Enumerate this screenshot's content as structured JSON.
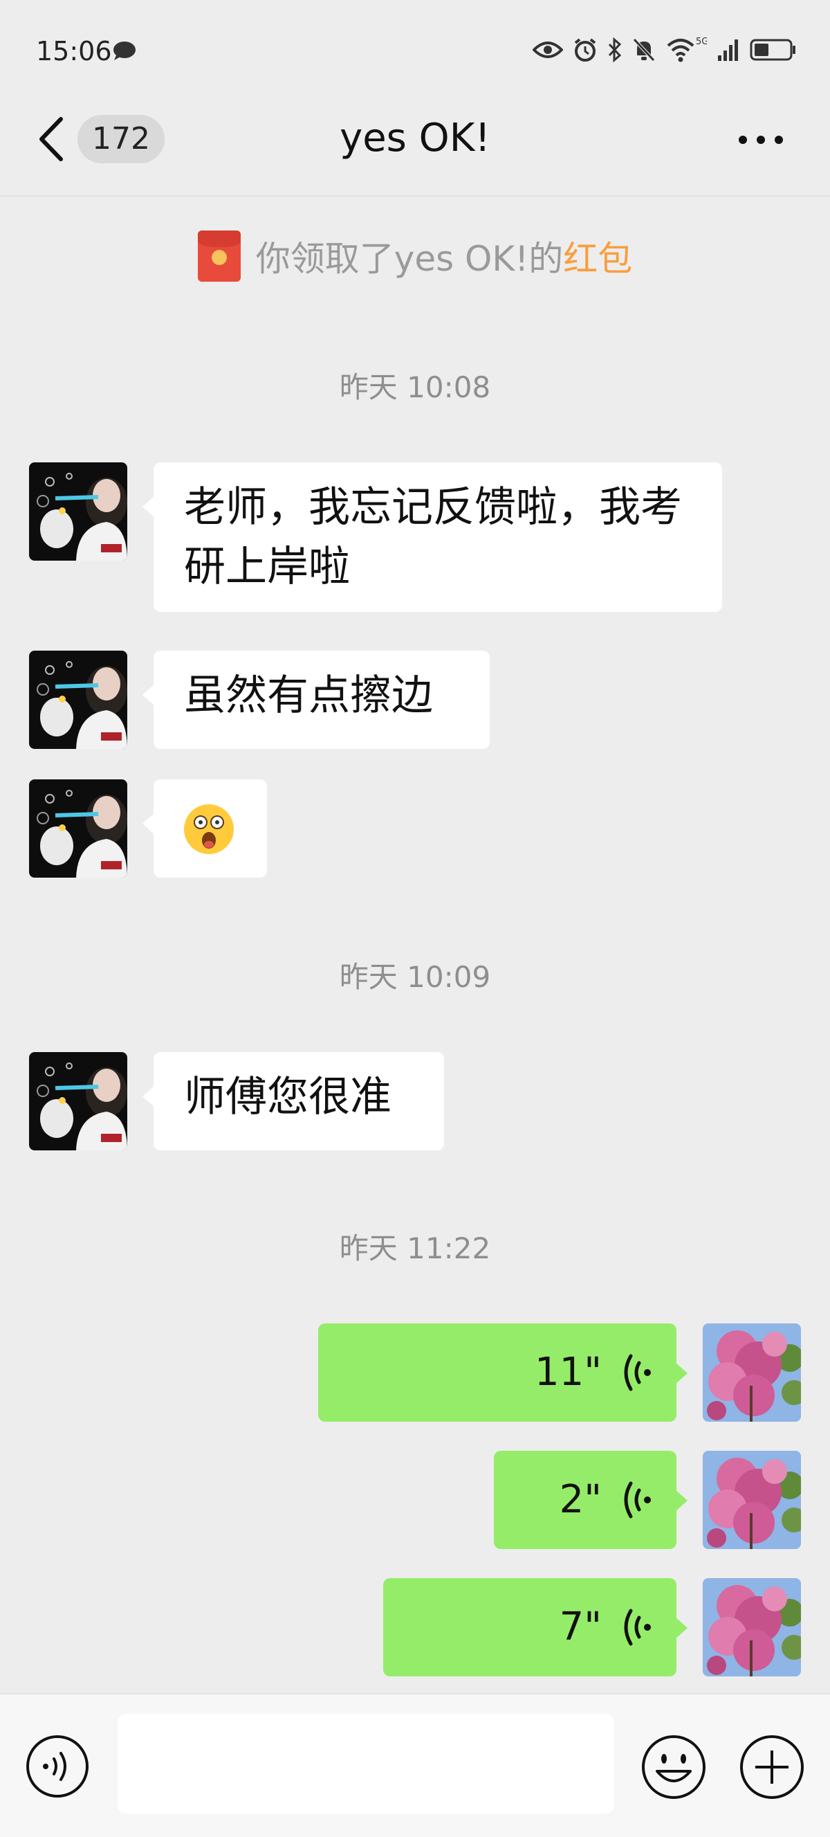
{
  "status_bar": {
    "time": "15:06",
    "network": "5G",
    "icons": [
      "chat-bubble-icon",
      "eye-icon",
      "alarm-icon",
      "bluetooth-icon",
      "mute-bell-icon",
      "wifi-icon",
      "signal-icon",
      "battery-icon"
    ]
  },
  "nav": {
    "unread_count": "172",
    "title": "yes OK!"
  },
  "notice": {
    "prefix": "你领取了yes OK!的",
    "link": "红包"
  },
  "messages": [
    {
      "type": "timestamp",
      "text": "昨天 10:08"
    },
    {
      "type": "text",
      "side": "left",
      "text": "老师，我忘记反馈啦，我考研上岸啦"
    },
    {
      "type": "text",
      "side": "left",
      "text": "虽然有点擦边"
    },
    {
      "type": "emoji",
      "side": "left",
      "text": "😲"
    },
    {
      "type": "timestamp",
      "text": "昨天 10:09"
    },
    {
      "type": "text",
      "side": "left",
      "text": "师傅您很准"
    },
    {
      "type": "timestamp",
      "text": "昨天 11:22"
    },
    {
      "type": "voice",
      "side": "right",
      "duration": "11\""
    },
    {
      "type": "voice",
      "side": "right",
      "duration": "2\""
    },
    {
      "type": "voice",
      "side": "right",
      "duration": "7\""
    }
  ],
  "colors": {
    "background": "#ededed",
    "sent_bubble": "#95ec69",
    "received_bubble": "#ffffff",
    "red_packet_link": "#fa9d3b"
  }
}
